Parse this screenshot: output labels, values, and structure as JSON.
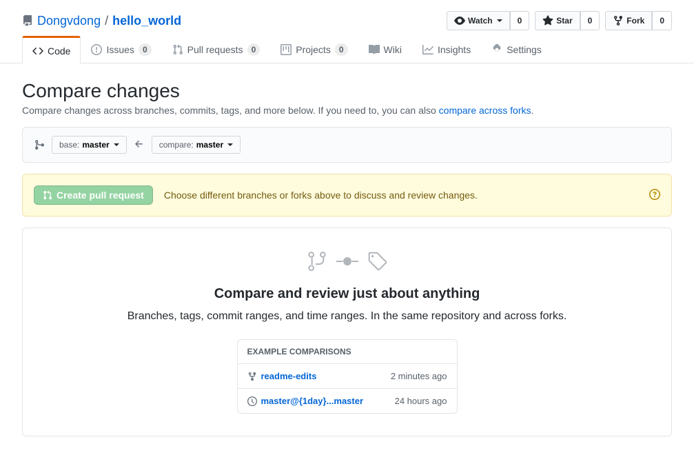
{
  "repo": {
    "owner": "Dongvdong",
    "name": "hello_world",
    "separator": "/"
  },
  "actions": {
    "watch": {
      "label": "Watch",
      "count": "0"
    },
    "star": {
      "label": "Star",
      "count": "0"
    },
    "fork": {
      "label": "Fork",
      "count": "0"
    }
  },
  "tabs": {
    "code": "Code",
    "issues": {
      "label": "Issues",
      "count": "0"
    },
    "pulls": {
      "label": "Pull requests",
      "count": "0"
    },
    "projects": {
      "label": "Projects",
      "count": "0"
    },
    "wiki": "Wiki",
    "insights": "Insights",
    "settings": "Settings"
  },
  "page": {
    "title": "Compare changes",
    "subtitle_prefix": "Compare changes across branches, commits, tags, and more below. If you need to, you can also ",
    "subtitle_link": "compare across forks",
    "subtitle_suffix": "."
  },
  "range": {
    "base_label": "base: ",
    "base_value": "master",
    "compare_label": "compare: ",
    "compare_value": "master"
  },
  "flash": {
    "button": "Create pull request",
    "text": "Choose different branches or forks above to discuss and review changes."
  },
  "blankslate": {
    "heading": "Compare and review just about anything",
    "text": "Branches, tags, commit ranges, and time ranges. In the same repository and across forks.",
    "example_header": "EXAMPLE COMPARISONS",
    "examples": [
      {
        "label": "readme-edits",
        "time": "2 minutes ago"
      },
      {
        "label": "master@{1day}...master",
        "time": "24 hours ago"
      }
    ]
  }
}
